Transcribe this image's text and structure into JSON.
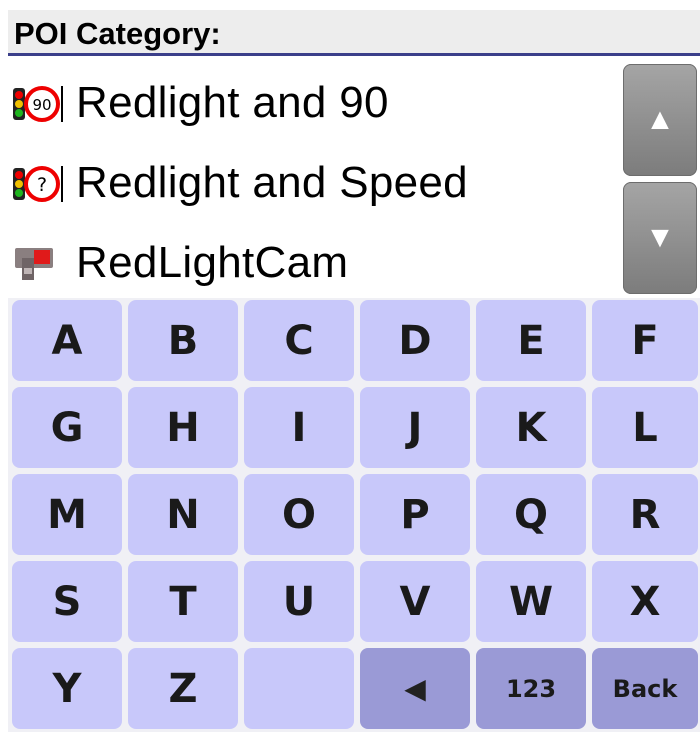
{
  "header": {
    "title": "POI Category:"
  },
  "list": {
    "items": [
      {
        "label": "Redlight and 90",
        "icon": "redlight-90-icon",
        "badge": "90"
      },
      {
        "label": "Redlight and Speed",
        "icon": "redlight-speed-icon",
        "badge": "?"
      },
      {
        "label": "RedLightCam",
        "icon": "redlight-camera-icon"
      }
    ]
  },
  "scroll": {
    "up": "▲",
    "down": "▼"
  },
  "keyboard": {
    "rows": [
      [
        "A",
        "B",
        "C",
        "D",
        "E",
        "F"
      ],
      [
        "G",
        "H",
        "I",
        "J",
        "K",
        "L"
      ],
      [
        "M",
        "N",
        "O",
        "P",
        "Q",
        "R"
      ],
      [
        "S",
        "T",
        "U",
        "V",
        "W",
        "X"
      ],
      [
        "Y",
        "Z"
      ]
    ],
    "backspace": "◀",
    "numbers": "123",
    "back": "Back"
  },
  "colors": {
    "key": "#c8c8fa",
    "key_dark": "#9a9ad6",
    "scroll": "#8f8f8f",
    "header_rule": "#3b3f8a"
  }
}
